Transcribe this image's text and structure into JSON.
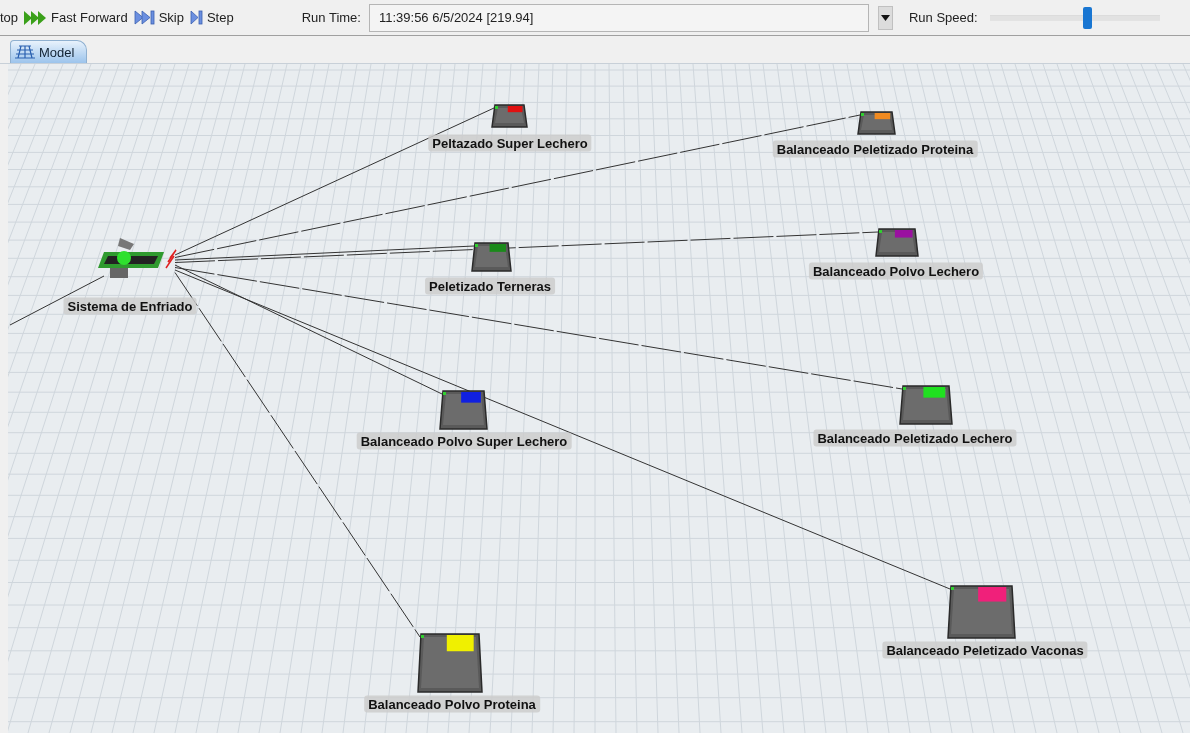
{
  "toolbar": {
    "buttons": [
      {
        "kind": "stop",
        "label": "top"
      },
      {
        "kind": "fast_forward",
        "label": "Fast Forward"
      },
      {
        "kind": "skip",
        "label": "Skip"
      },
      {
        "kind": "step",
        "label": "Step"
      }
    ],
    "run_time": {
      "label": "Run Time:",
      "value": "11:39:56  6/5/2024  [219.94]"
    },
    "run_speed": {
      "label": "Run Speed:",
      "level": 0.57
    }
  },
  "tabs": [
    {
      "label": "Model",
      "selected": true
    }
  ],
  "model": {
    "source": {
      "label": "Sistema de Enfriado"
    },
    "stations": [
      {
        "label": "Peltazado Super Lechero",
        "color": "#e01010"
      },
      {
        "label": "Balanceado Peletizado Proteina",
        "color": "#f08a20"
      },
      {
        "label": "Peletizado Terneras",
        "color": "#1a8a1a"
      },
      {
        "label": "Balanceado Polvo Lechero",
        "color": "#9a10a0"
      },
      {
        "label": "Balanceado Polvo Super Lechero",
        "color": "#1020e0"
      },
      {
        "label": "Balanceado Peletizado Lechero",
        "color": "#20e020"
      },
      {
        "label": "Balanceado Peletizado Vaconas",
        "color": "#f0207a"
      },
      {
        "label": "Balanceado Polvo Proteina",
        "color": "#f0f000"
      }
    ]
  }
}
